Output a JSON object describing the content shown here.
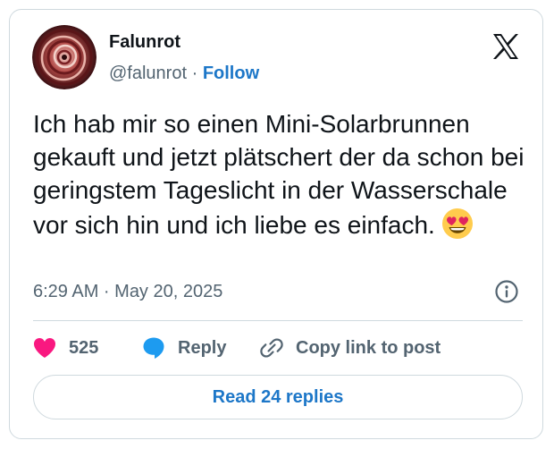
{
  "author": {
    "display_name": "Falunrot",
    "handle": "@falunrot",
    "separator": "·",
    "follow_label": "Follow"
  },
  "tweet": {
    "text": "Ich hab mir so einen Mini-Solarbrunnen gekauft und jetzt plätschert der da schon bei geringstem Tageslicht in der Wasserschale vor sich hin und ich liebe es einfach.",
    "emoji": "smiling-face-with-heart-eyes",
    "timestamp": "6:29 AM · May 20, 2025"
  },
  "actions": {
    "like_count": "525",
    "reply_label": "Reply",
    "copy_link_label": "Copy link to post"
  },
  "read_replies_label": "Read 24 replies",
  "icons": {
    "brand": "x-logo-icon",
    "info": "info-icon",
    "like": "heart-icon",
    "reply": "speech-bubble-icon",
    "copy": "link-icon"
  },
  "colors": {
    "accent_blue": "#1d77c8",
    "heart_pink": "#f91880",
    "reply_blue": "#1d9bf0",
    "muted_text": "#536471",
    "border": "#cfd9de"
  }
}
